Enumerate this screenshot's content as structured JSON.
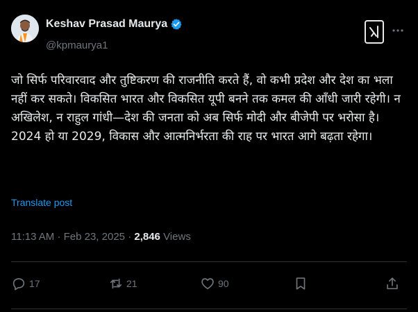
{
  "author": {
    "display_name": "Keshav Prasad Maurya",
    "handle": "@kpmaurya1",
    "verified": true
  },
  "post": {
    "text": "जो सिर्फ परिवारवाद और तुष्टिकरण की राजनीति करते हैं, वो कभी प्रदेश और देश का भला नहीं कर सकते। विकसित भारत और विकसित यूपी बनने तक कमल की आँधी जारी रहेगी। न अखिलेश, न राहुल गांधी—देश की जनता को अब सिर्फ मोदी और बीजेपी पर भरोसा है। 2024 हो या 2029, विकास और आत्मनिर्भरता की राह पर भारत आगे बढ़ता रहेगा।",
    "translate_label": "Translate post",
    "time": "11:13 AM",
    "separator": "·",
    "date": "Feb 23, 2025",
    "views_count": "2,846",
    "views_label": "Views"
  },
  "actions": {
    "replies": "17",
    "reposts": "21",
    "likes": "90"
  },
  "colors": {
    "background": "#000000",
    "text": "#e7e9ea",
    "muted": "#71767b",
    "link": "#1d9bf0",
    "verified": "#1d9bf0"
  },
  "icons": [
    "verified-badge-icon",
    "grok-icon",
    "more-icon",
    "reply-icon",
    "repost-icon",
    "like-icon",
    "bookmark-icon",
    "share-icon"
  ]
}
